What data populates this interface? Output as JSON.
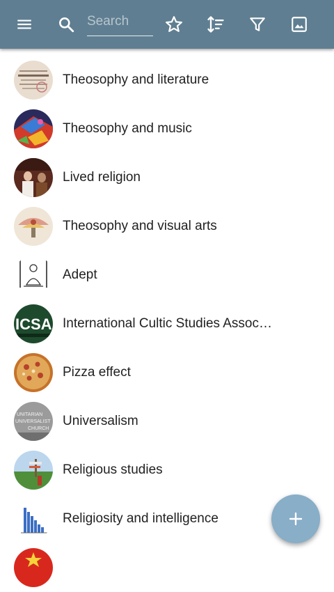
{
  "toolbar": {
    "background": "#5f7e91",
    "icons": [
      "menu-icon",
      "search-icon",
      "star-icon",
      "sort-icon",
      "filter-icon",
      "image-icon"
    ],
    "search_placeholder": "Search"
  },
  "list": {
    "items": [
      {
        "label": "Theosophy and literature",
        "avatar": "old-book-page"
      },
      {
        "label": "Theosophy and music",
        "avatar": "colorful-painting"
      },
      {
        "label": "Lived religion",
        "avatar": "people-photo"
      },
      {
        "label": "Theosophy and visual arts",
        "avatar": "illustration"
      },
      {
        "label": "Adept",
        "avatar": "meditating-figure-drawing"
      },
      {
        "label": "International Cultic Studies Association",
        "avatar": "icsa-logo"
      },
      {
        "label": "Pizza effect",
        "avatar": "pizza-photo"
      },
      {
        "label": "Universalism",
        "avatar": "unitarian-universalist-church-sign"
      },
      {
        "label": "Religious studies",
        "avatar": "outdoor-photo"
      },
      {
        "label": "Religiosity and intelligence",
        "avatar": "bar-chart-image"
      },
      {
        "label": "",
        "avatar": "red-image"
      }
    ]
  },
  "avatar_text": {
    "icsa": "ICSA",
    "unitarian": [
      "UNITARIAN",
      "UNIVERSALIST",
      "CHURCH"
    ]
  },
  "fab": {
    "icon": "plus-icon",
    "color": "#88aec8"
  }
}
